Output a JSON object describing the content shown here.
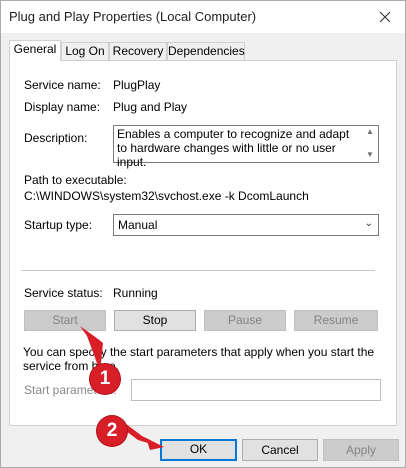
{
  "window": {
    "title": "Plug and Play Properties (Local Computer)"
  },
  "tabs": [
    "General",
    "Log On",
    "Recovery",
    "Dependencies"
  ],
  "general": {
    "service_name_label": "Service name:",
    "service_name_value": "PlugPlay",
    "display_name_label": "Display name:",
    "display_name_value": "Plug and Play",
    "description_label": "Description:",
    "description_value": "Enables a computer to recognize and adapt to hardware changes with little or no user input.",
    "path_label": "Path to executable:",
    "path_value": "C:\\WINDOWS\\system32\\svchost.exe -k DcomLaunch",
    "startup_type_label": "Startup type:",
    "startup_type_value": "Manual",
    "service_status_label": "Service status:",
    "service_status_value": "Running",
    "buttons": {
      "start": "Start",
      "stop": "Stop",
      "pause": "Pause",
      "resume": "Resume"
    },
    "info_text": "You can specify the start parameters that apply when you start the service from here.",
    "start_params_label": "Start parameters:",
    "start_params_value": ""
  },
  "footer": {
    "ok": "OK",
    "cancel": "Cancel",
    "apply": "Apply"
  },
  "annotations": {
    "marker_1": "1",
    "marker_2": "2"
  },
  "colors": {
    "marker": "#d81e27",
    "default_button_border": "#0078d7"
  }
}
